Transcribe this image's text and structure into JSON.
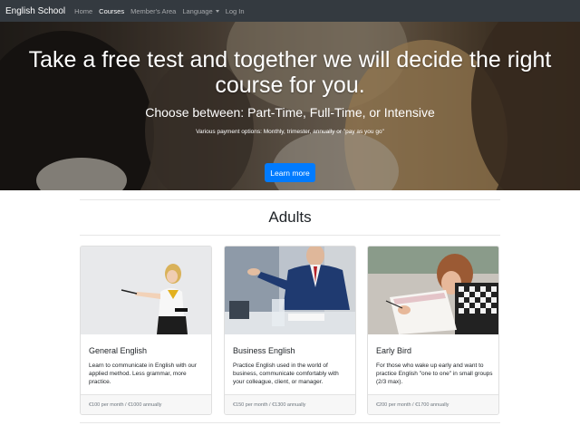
{
  "nav": {
    "brand": "English School",
    "items": [
      {
        "label": "Home"
      },
      {
        "label": "Courses"
      },
      {
        "label": "Member's Area"
      },
      {
        "label": "Language"
      },
      {
        "label": "Log In"
      }
    ]
  },
  "hero": {
    "title": "Take a free test and together we will decide the right course for you.",
    "subtitle_prefix": "Choose between: ",
    "subtitle_options": "Part-Time, Full-Time, or Intensive",
    "note": "Various payment options: Monthly, trimester, annually or \"pay as you go\"",
    "button_label": "Learn more"
  },
  "section": {
    "title": "Adults"
  },
  "cards": [
    {
      "title": "General English",
      "text": "Learn to communicate in English with our applied method. Less grammar, more practice.",
      "footer": "€100 per month / €1000 annually"
    },
    {
      "title": "Business English",
      "text": "Practice English used in the world of business, communicate comfortably with your colleague, client, or manager.",
      "footer": "€150 per month / €1300 annually"
    },
    {
      "title": "Early Bird",
      "text": "For those who wake up early and want to practice English \"one to one\" in small groups (2/3 max).",
      "footer": "€200 per month / €1700 annually"
    }
  ],
  "colors": {
    "navbar": "#343a40",
    "primary": "#007bff"
  }
}
